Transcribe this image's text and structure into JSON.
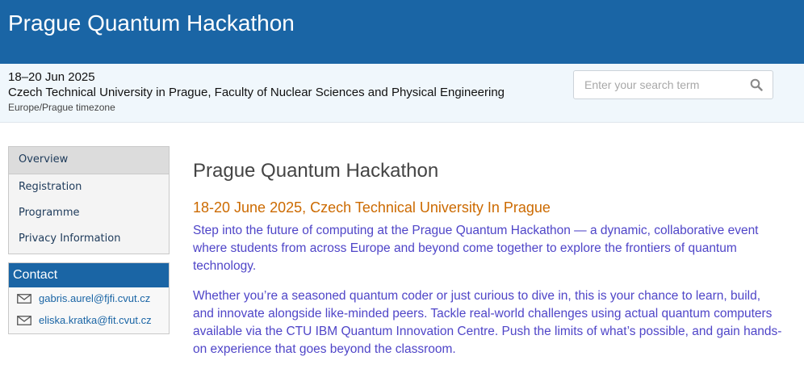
{
  "header": {
    "title": "Prague Quantum Hackathon"
  },
  "event_info": {
    "date": "18–20 Jun 2025",
    "venue": "Czech Technical University in Prague, Faculty of Nuclear Sciences and Physical Engineering",
    "timezone": "Europe/Prague timezone"
  },
  "search": {
    "placeholder": "Enter your search term",
    "icon": "search-icon"
  },
  "menu": {
    "items": [
      {
        "label": "Overview",
        "active": true
      },
      {
        "label": "Registration",
        "active": false
      },
      {
        "label": "Programme",
        "active": false
      },
      {
        "label": "Privacy Information",
        "active": false
      }
    ]
  },
  "contact": {
    "heading": "Contact",
    "emails": [
      "gabris.aurel@fjfi.cvut.cz",
      "eliska.kratka@fit.cvut.cz"
    ],
    "icon": "envelope-icon"
  },
  "content": {
    "title": "Prague Quantum Hackathon",
    "subtitle": "18-20 June 2025, Czech Technical University In Prague",
    "paragraphs": [
      "Step into the future of computing at the Prague Quantum Hackathon — a dynamic, collaborative event where students from across Europe and beyond come together to explore the frontiers of quantum technology.",
      "Whether you’re a seasoned quantum coder or just curious to dive in, this is your chance to learn, build, and innovate alongside like-minded peers. Tackle real-world challenges using actual quantum computers available via the CTU IBM Quantum Innovation Centre. Push the limits of what’s possible, and gain hands-on experience that goes beyond the classroom."
    ]
  },
  "colors": {
    "header_bg": "#1a65a5",
    "subtitle": "#cc6a00",
    "body_text": "#4f45c8",
    "link": "#1a65a5"
  }
}
